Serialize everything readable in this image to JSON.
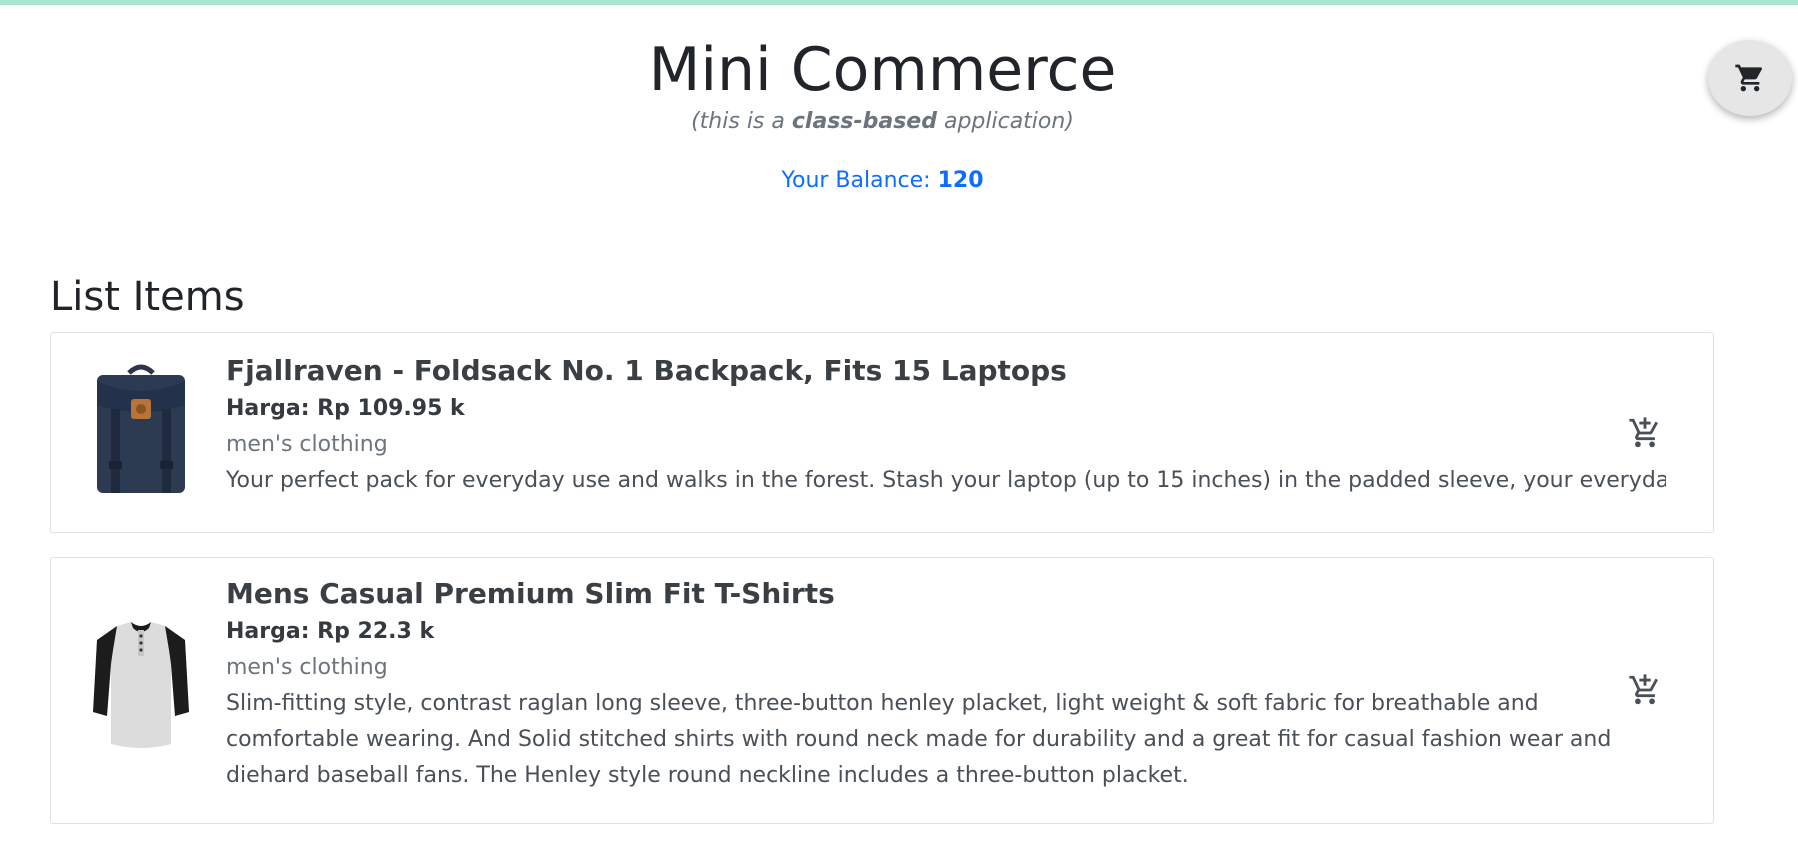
{
  "header": {
    "title": "Mini Commerce",
    "subtitle_prefix": "(this is a ",
    "subtitle_bold": "class-based",
    "subtitle_suffix": " application)",
    "balance_label": "Your Balance: ",
    "balance_value": "120"
  },
  "cart": {
    "icon": "shopping-cart-icon"
  },
  "list": {
    "heading": "List Items",
    "items": [
      {
        "title": "Fjallraven - Foldsack No. 1 Backpack, Fits 15 Laptops",
        "price": "Harga: Rp 109.95 k",
        "category": "men's clothing",
        "description": "Your perfect pack for everyday use and walks in the forest. Stash your laptop (up to 15 inches) in the padded sleeve, your everyday",
        "image": "backpack-image",
        "action_icon": "add-to-cart-icon"
      },
      {
        "title": "Mens Casual Premium Slim Fit T-Shirts",
        "price": "Harga: Rp 22.3 k",
        "category": "men's clothing",
        "description": "Slim-fitting style, contrast raglan long sleeve, three-button henley placket, light weight & soft fabric for breathable and comfortable wearing. And Solid stitched shirts with round neck made for durability and a great fit for casual fashion wear and diehard baseball fans. The Henley style round neckline includes a three-button placket.",
        "image": "tshirt-image",
        "action_icon": "add-to-cart-icon"
      }
    ]
  },
  "colors": {
    "top_bar": "#a8e6cf",
    "accent": "#0d6efd",
    "muted": "#6c757d"
  }
}
